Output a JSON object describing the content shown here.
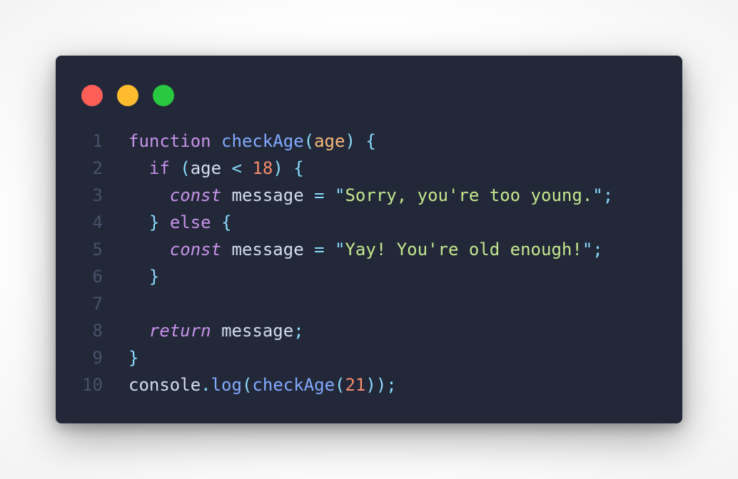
{
  "window": {
    "buttons": [
      {
        "name": "close",
        "color": "#ff5f57"
      },
      {
        "name": "minimize",
        "color": "#febc2e"
      },
      {
        "name": "zoom",
        "color": "#28c840"
      }
    ],
    "background": "#232839"
  },
  "code": {
    "language": "javascript",
    "lines": [
      {
        "number": "1",
        "tokens": [
          {
            "t": "kw",
            "v": "function"
          },
          {
            "t": "plain",
            "v": " "
          },
          {
            "t": "fn",
            "v": "checkAge"
          },
          {
            "t": "punc",
            "v": "("
          },
          {
            "t": "param",
            "v": "age"
          },
          {
            "t": "punc",
            "v": ")"
          },
          {
            "t": "plain",
            "v": " "
          },
          {
            "t": "punc",
            "v": "{"
          }
        ]
      },
      {
        "number": "2",
        "tokens": [
          {
            "t": "plain",
            "v": "  "
          },
          {
            "t": "kw",
            "v": "if"
          },
          {
            "t": "plain",
            "v": " "
          },
          {
            "t": "punc",
            "v": "("
          },
          {
            "t": "ident",
            "v": "age"
          },
          {
            "t": "plain",
            "v": " "
          },
          {
            "t": "op",
            "v": "<"
          },
          {
            "t": "plain",
            "v": " "
          },
          {
            "t": "num",
            "v": "18"
          },
          {
            "t": "punc",
            "v": ")"
          },
          {
            "t": "plain",
            "v": " "
          },
          {
            "t": "punc",
            "v": "{"
          }
        ]
      },
      {
        "number": "3",
        "tokens": [
          {
            "t": "plain",
            "v": "    "
          },
          {
            "t": "kw-it",
            "v": "const"
          },
          {
            "t": "plain",
            "v": " "
          },
          {
            "t": "ident",
            "v": "message"
          },
          {
            "t": "plain",
            "v": " "
          },
          {
            "t": "op",
            "v": "="
          },
          {
            "t": "plain",
            "v": " "
          },
          {
            "t": "punc",
            "v": "\""
          },
          {
            "t": "str",
            "v": "Sorry, you're too young."
          },
          {
            "t": "punc",
            "v": "\""
          },
          {
            "t": "punc",
            "v": ";"
          }
        ]
      },
      {
        "number": "4",
        "tokens": [
          {
            "t": "plain",
            "v": "  "
          },
          {
            "t": "punc",
            "v": "}"
          },
          {
            "t": "plain",
            "v": " "
          },
          {
            "t": "kw",
            "v": "else"
          },
          {
            "t": "plain",
            "v": " "
          },
          {
            "t": "punc",
            "v": "{"
          }
        ]
      },
      {
        "number": "5",
        "tokens": [
          {
            "t": "plain",
            "v": "    "
          },
          {
            "t": "kw-it",
            "v": "const"
          },
          {
            "t": "plain",
            "v": " "
          },
          {
            "t": "ident",
            "v": "message"
          },
          {
            "t": "plain",
            "v": " "
          },
          {
            "t": "op",
            "v": "="
          },
          {
            "t": "plain",
            "v": " "
          },
          {
            "t": "punc",
            "v": "\""
          },
          {
            "t": "str",
            "v": "Yay! You're old enough!"
          },
          {
            "t": "punc",
            "v": "\""
          },
          {
            "t": "punc",
            "v": ";"
          }
        ]
      },
      {
        "number": "6",
        "tokens": [
          {
            "t": "plain",
            "v": "  "
          },
          {
            "t": "punc",
            "v": "}"
          }
        ]
      },
      {
        "number": "7",
        "tokens": []
      },
      {
        "number": "8",
        "tokens": [
          {
            "t": "plain",
            "v": "  "
          },
          {
            "t": "kw-it",
            "v": "return"
          },
          {
            "t": "plain",
            "v": " "
          },
          {
            "t": "ident",
            "v": "message"
          },
          {
            "t": "punc",
            "v": ";"
          }
        ]
      },
      {
        "number": "9",
        "tokens": [
          {
            "t": "punc",
            "v": "}"
          }
        ]
      },
      {
        "number": "10",
        "tokens": [
          {
            "t": "ident",
            "v": "console"
          },
          {
            "t": "punc",
            "v": "."
          },
          {
            "t": "fn",
            "v": "log"
          },
          {
            "t": "punc",
            "v": "("
          },
          {
            "t": "fn",
            "v": "checkAge"
          },
          {
            "t": "punc",
            "v": "("
          },
          {
            "t": "num",
            "v": "21"
          },
          {
            "t": "punc",
            "v": ")"
          },
          {
            "t": "punc",
            "v": ")"
          },
          {
            "t": "punc",
            "v": ";"
          }
        ]
      }
    ]
  }
}
